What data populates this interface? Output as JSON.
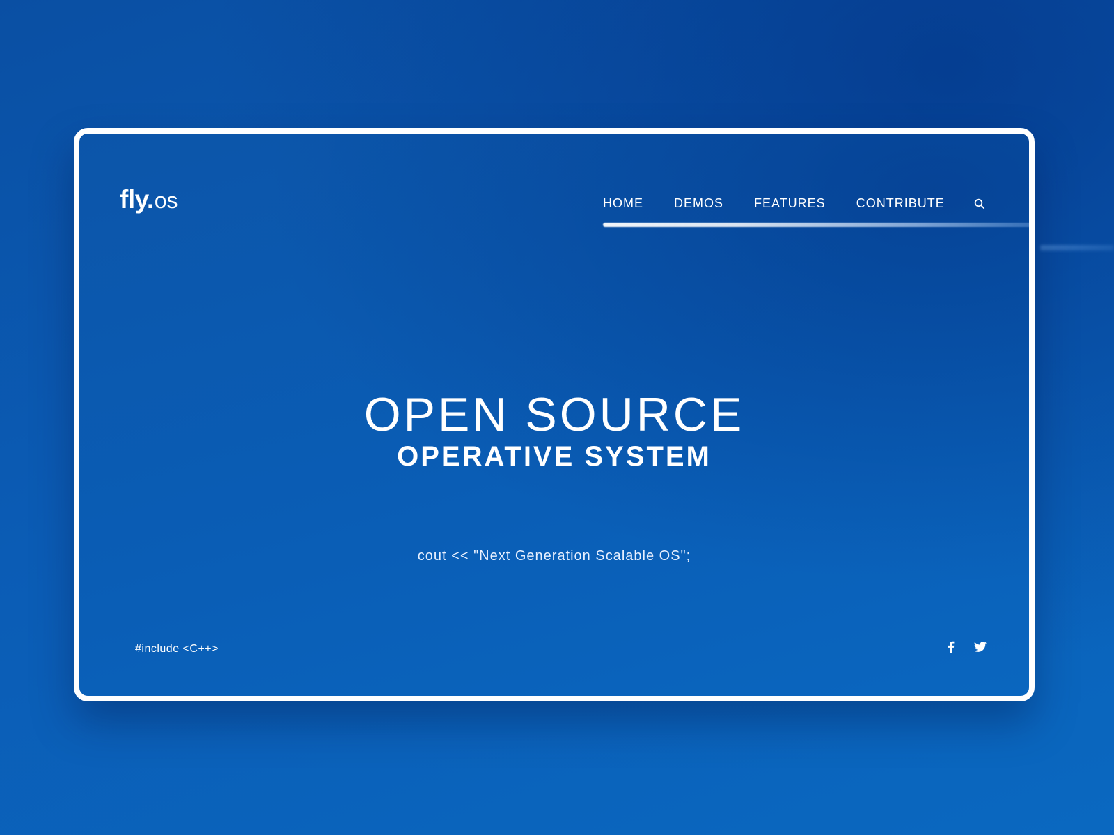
{
  "brand": {
    "name_main": "fly.",
    "name_suffix": "os"
  },
  "nav": {
    "items": [
      {
        "label": "HOME"
      },
      {
        "label": "DEMOS"
      },
      {
        "label": "FEATURES"
      },
      {
        "label": "CONTRIBUTE"
      }
    ],
    "search_icon": "search-icon"
  },
  "hero": {
    "title": "OPEN SOURCE",
    "subtitle": "OPERATIVE SYSTEM",
    "tagline": "cout << \"Next Generation Scalable OS\";"
  },
  "footer": {
    "code_label": "#include <C++>",
    "social": [
      {
        "icon": "facebook-icon"
      },
      {
        "icon": "twitter-icon"
      }
    ]
  },
  "colors": {
    "background": "#0a5cb5",
    "frame_border": "#ffffff",
    "text": "#ffffff"
  }
}
